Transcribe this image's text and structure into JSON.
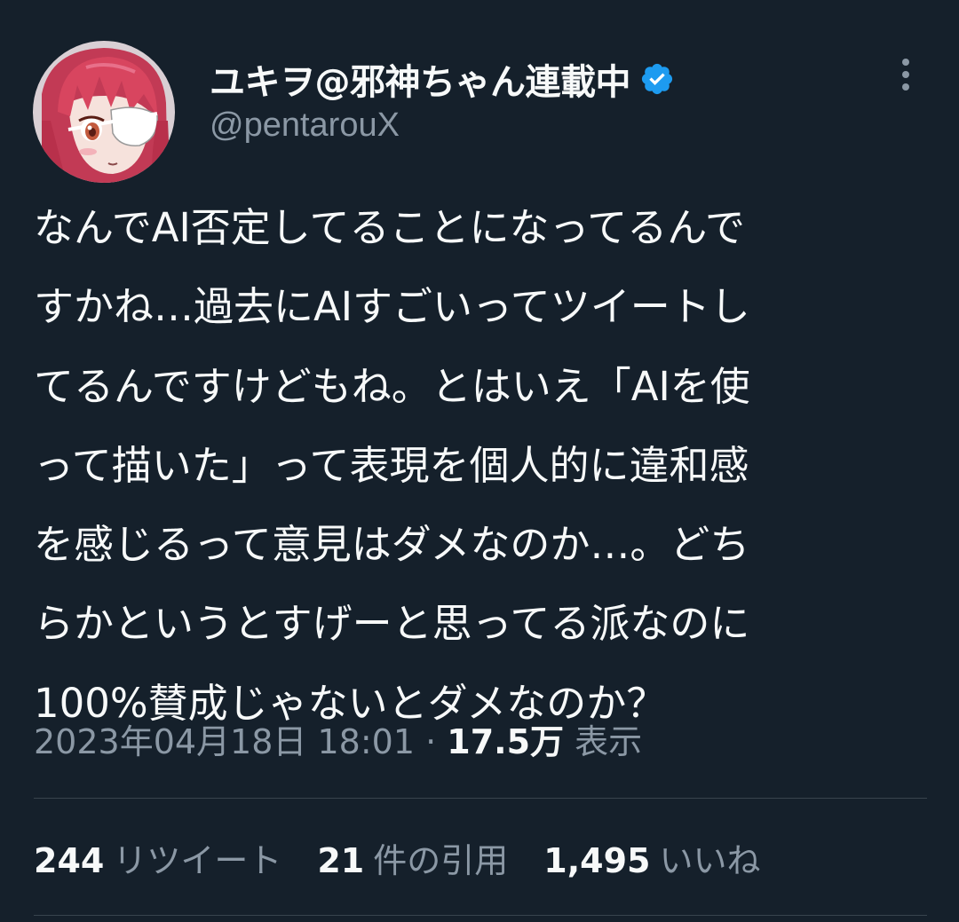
{
  "author": {
    "display_name": "ユキヲ@邪神ちゃん連載中",
    "handle": "@pentarouX",
    "verified_icon": "verified-badge-icon",
    "avatar_icon": "avatar-anime-girl-eyepatch"
  },
  "more_icon": "more-vertical-icon",
  "tweet": {
    "text": "なんでAI否定してることになってるんで\nすかね…過去にAIすごいってツイートし\nてるんですけどもね。とはいえ「AIを使\nって描いた」って表現を個人的に違和感\nを感じるって意見はダメなのか…。どち\nらかというとすげーと思ってる派なのに\n100%賛成じゃないとダメなのか？",
    "timestamp": "2023年04月18日 18:01",
    "separator": "·",
    "views_count": "17.5万",
    "views_label": "表示"
  },
  "stats": {
    "retweets_count": "244",
    "retweets_label": "リツイート",
    "quotes_count": "21",
    "quotes_label": "件の引用",
    "likes_count": "1,495",
    "likes_label": "いいね"
  },
  "colors": {
    "background": "#15202b",
    "text_primary": "#f7f9f9",
    "text_secondary": "#8b98a5",
    "divider": "#38444d",
    "verified": "#1d9bf0"
  }
}
